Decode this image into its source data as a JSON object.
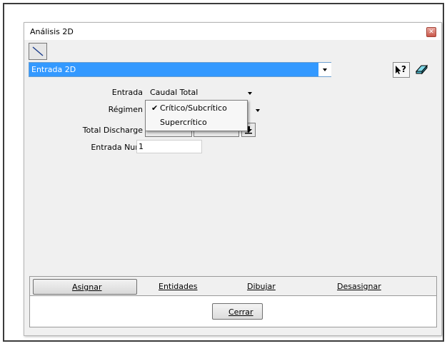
{
  "window": {
    "title": "Análisis 2D"
  },
  "mode_select": {
    "value": "Entrada 2D"
  },
  "form": {
    "entrada": {
      "label": "Entrada",
      "value": "Caudal Total"
    },
    "regimen": {
      "label": "Régimen"
    },
    "total_discharge": {
      "label": "Total Discharge"
    },
    "entrada_num": {
      "label": "Entrada Num",
      "value": "1"
    }
  },
  "regimen_dropdown": {
    "options": [
      {
        "label": "Crítico/Subcrítico",
        "checked": true
      },
      {
        "label": "Supercrítico",
        "checked": false
      }
    ],
    "check_mark": "✔"
  },
  "action_bar": {
    "buttons": [
      {
        "label": "Asignar",
        "active": true
      },
      {
        "label": "Entidades",
        "active": false
      },
      {
        "label": "Dibujar",
        "active": false
      },
      {
        "label": "Desasignar",
        "active": false
      }
    ]
  },
  "footer": {
    "close_label": "Cerrar"
  },
  "colors": {
    "selection_blue": "#3399ff",
    "dialog_bg": "#f0f0f0",
    "close_red": "#c9574a"
  },
  "icons": {
    "draw_tool": "diagonal-line-icon",
    "help": "help-pointer-icon",
    "eraser": "eraser-icon",
    "download": "download-arrow-icon",
    "close": "close-icon"
  }
}
